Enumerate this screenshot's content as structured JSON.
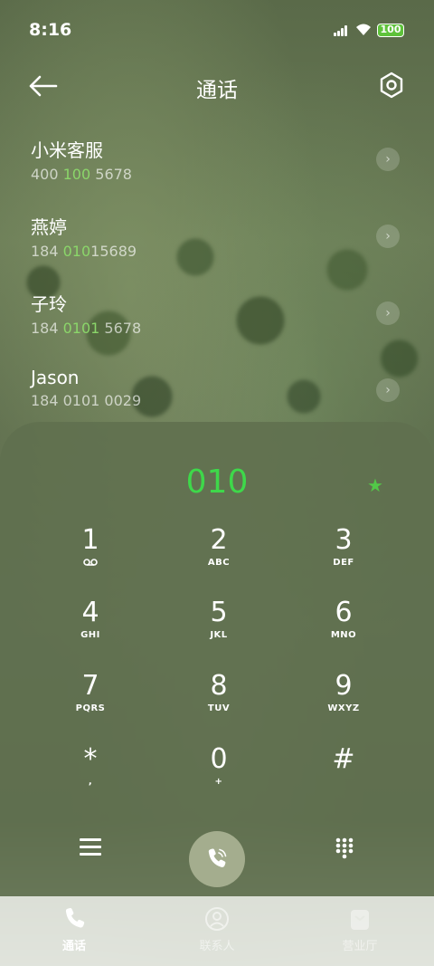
{
  "status_bar": {
    "time": "8:16",
    "battery": "100"
  },
  "header": {
    "title": "通话"
  },
  "contacts": [
    {
      "name": "小米客服",
      "number_pre": "400 ",
      "number_hl": "100",
      "number_post": " 5678"
    },
    {
      "name": "燕婷",
      "number_pre": "184 ",
      "number_hl": "010",
      "number_post": "15689"
    },
    {
      "name": "子玲",
      "number_pre": "184 ",
      "number_hl": "0101",
      "number_post": " 5678"
    },
    {
      "name": "Jason",
      "number_pre": "184 0101 0029",
      "number_hl": "",
      "number_post": ""
    }
  ],
  "dialer": {
    "input": "010",
    "keys": [
      {
        "digit": "1",
        "sub": ""
      },
      {
        "digit": "2",
        "sub": "ABC"
      },
      {
        "digit": "3",
        "sub": "DEF"
      },
      {
        "digit": "4",
        "sub": "GHI"
      },
      {
        "digit": "5",
        "sub": "JKL"
      },
      {
        "digit": "6",
        "sub": "MNO"
      },
      {
        "digit": "7",
        "sub": "PQRS"
      },
      {
        "digit": "8",
        "sub": "TUV"
      },
      {
        "digit": "9",
        "sub": "WXYZ"
      },
      {
        "digit": "*",
        "sub": ","
      },
      {
        "digit": "0",
        "sub": "+"
      },
      {
        "digit": "#",
        "sub": ""
      }
    ]
  },
  "tabs": [
    {
      "label": "通话",
      "icon": "phone-icon",
      "active": true
    },
    {
      "label": "联系人",
      "icon": "person-icon",
      "active": false
    },
    {
      "label": "营业厅",
      "icon": "store-icon",
      "active": false
    }
  ],
  "colors": {
    "accent_green": "#3ed84a",
    "highlight_green": "#8bd66a",
    "battery_green": "#5ec23a"
  }
}
